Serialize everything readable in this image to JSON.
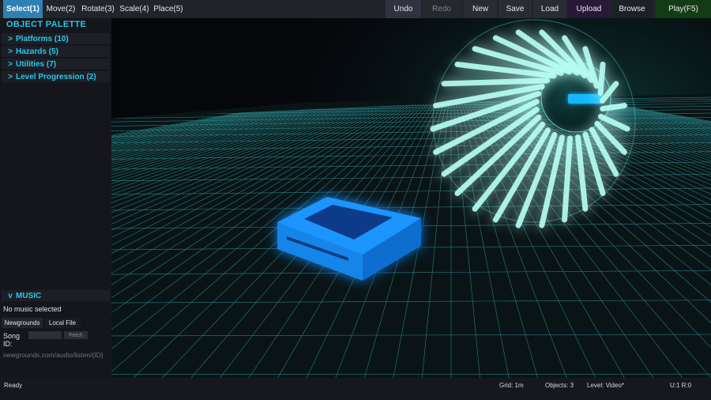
{
  "toolbar": {
    "tools": [
      {
        "label": "Select(1)",
        "active": true
      },
      {
        "label": "Move(2)",
        "active": false
      },
      {
        "label": "Rotate(3)",
        "active": false
      },
      {
        "label": "Scale(4)",
        "active": false
      },
      {
        "label": "Place(5)",
        "active": false
      }
    ],
    "undo": "Undo",
    "redo": "Redo",
    "new": "New",
    "save": "Save",
    "load": "Load",
    "upload": "Upload",
    "browse": "Browse",
    "play": "Play(F5)"
  },
  "palette": {
    "title": "OBJECT PALETTE",
    "categories": [
      {
        "chevron": ">",
        "label": "Platforms (10)"
      },
      {
        "chevron": ">",
        "label": "Hazards (5)"
      },
      {
        "chevron": ">",
        "label": "Utilities (7)"
      },
      {
        "chevron": ">",
        "label": "Level Progression (2)"
      }
    ]
  },
  "music": {
    "chevron": "v",
    "title": "MUSIC",
    "status": "No music selected",
    "tabs": [
      "Newgrounds",
      "Local File"
    ],
    "song_id_label": "Song ID:",
    "song_id_value": "",
    "fetch": "Fetch",
    "url_hint": "newgrounds.com/audio/listen/{ID}"
  },
  "status": {
    "ready": "Ready",
    "grid": "Grid: 1m",
    "objects": "Objects: 3",
    "level": "Level: Video*",
    "undo_redo": "U:1 R:0"
  },
  "colors": {
    "accent": "#2bc6ea",
    "active_tool": "#2f80b4",
    "upload_bg": "#2a1838",
    "play_bg": "#123d14",
    "grid_line": "#3fd6dc",
    "platform_glow": "#19a6ff",
    "ring_glow": "#6ff2e4"
  }
}
